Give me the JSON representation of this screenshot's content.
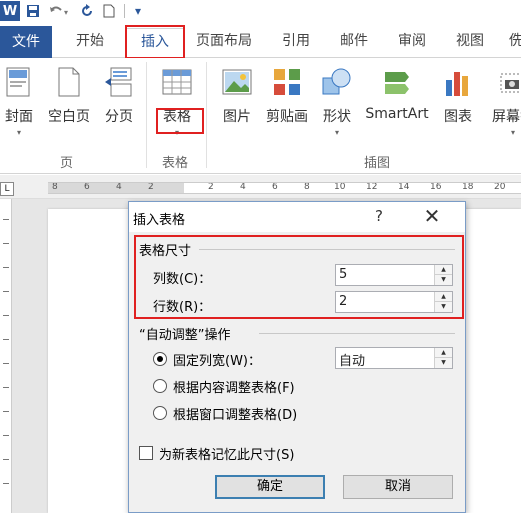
{
  "qat": {
    "word_icon": "W",
    "save_icon": "save-icon",
    "undo_icon": "undo-icon",
    "redo_icon": "redo-icon",
    "new_icon": "new-doc-icon",
    "more_icon": "▾"
  },
  "tabs": [
    {
      "label": "文件"
    },
    {
      "label": "开始"
    },
    {
      "label": "插入"
    },
    {
      "label": "页面布局"
    },
    {
      "label": "引用"
    },
    {
      "label": "邮件"
    },
    {
      "label": "审阅"
    },
    {
      "label": "视图"
    },
    {
      "label": "侁"
    }
  ],
  "ribbon": {
    "pages_group": {
      "label": "页",
      "buttons": [
        {
          "label": "封面"
        },
        {
          "label": "空白页"
        },
        {
          "label": "分页"
        }
      ]
    },
    "table_group": {
      "label": "表格",
      "buttons": [
        {
          "label": "表格"
        }
      ]
    },
    "illustrations_group": {
      "label": "插图",
      "buttons": [
        {
          "label": "图片"
        },
        {
          "label": "剪贴画"
        },
        {
          "label": "形状"
        },
        {
          "label": "SmartArt"
        },
        {
          "label": "图表"
        },
        {
          "label": "屏幕截"
        }
      ]
    }
  },
  "ruler": {
    "tab_marker": "L",
    "ticks": [
      "8",
      "6",
      "4",
      "2",
      "2",
      "4",
      "6",
      "8",
      "10",
      "12",
      "14",
      "16",
      "18",
      "20"
    ]
  },
  "dialog": {
    "title": "插入表格",
    "help": "?",
    "close": "✕",
    "table_size": {
      "title": "表格尺寸",
      "columns_label": "列数(C)：",
      "columns_value": "5",
      "rows_label": "行数(R)：",
      "rows_value": "2"
    },
    "autofit": {
      "title": "“自动调整”操作",
      "fixed_label": "固定列宽(W)：",
      "fixed_value": "自动",
      "content_label": "根据内容调整表格(F)",
      "window_label": "根据窗口调整表格(D)"
    },
    "remember_label": "为新表格记忆此尺寸(S)",
    "ok": "确定",
    "cancel": "取消"
  },
  "colors": {
    "accent": "#2b579a",
    "highlight": "#e02020"
  }
}
